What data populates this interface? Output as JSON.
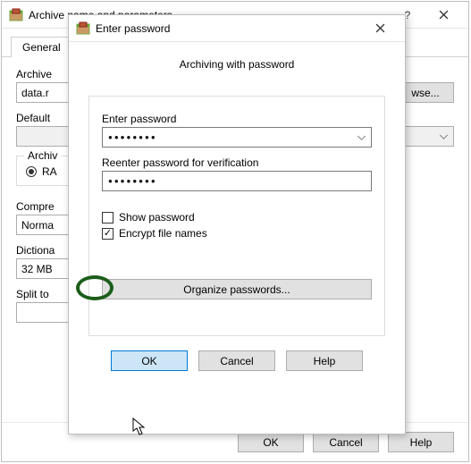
{
  "parent": {
    "title": "Archive name and parameters",
    "tab_general": "General",
    "archive_name_label": "Archive",
    "archive_name_value": "data.r",
    "browse_btn": "wse...",
    "default_label": "Default",
    "archive_format_group": "Archiv",
    "rar_label": "RA",
    "compression_label": "Compre",
    "compression_value": "Norma",
    "dictionary_label": "Dictiona",
    "dictionary_value": "32 MB",
    "split_label": "Split to",
    "ok": "OK",
    "cancel": "Cancel",
    "help": "Help"
  },
  "dialog": {
    "title": "Enter password",
    "heading": "Archiving with password",
    "enter_pw_label": "Enter password",
    "pw_value": "●●●●●●●●",
    "reenter_label": "Reenter password for verification",
    "pw2_value": "●●●●●●●●",
    "show_pw": "Show password",
    "encrypt_names": "Encrypt file names",
    "organize": "Organize passwords...",
    "ok": "OK",
    "cancel": "Cancel",
    "help": "Help",
    "show_pw_checked": false,
    "encrypt_checked": true
  }
}
